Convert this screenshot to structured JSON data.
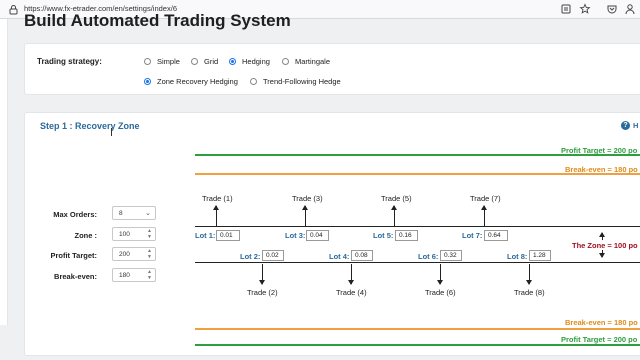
{
  "browser": {
    "url": "https://www.fx-etrader.com/en/settings/index/6"
  },
  "page": {
    "title": "Build Automated Trading System"
  },
  "strategy": {
    "label": "Trading strategy:",
    "options": [
      {
        "label": "Simple",
        "selected": false
      },
      {
        "label": "Grid",
        "selected": false
      },
      {
        "label": "Hedging",
        "selected": true
      },
      {
        "label": "Martingale",
        "selected": false
      }
    ],
    "hedging_options": [
      {
        "label": "Zone Recovery Hedging",
        "selected": true
      },
      {
        "label": "Trend-Following Hedge",
        "selected": false
      }
    ]
  },
  "step": {
    "title": "Step 1 : Recovery Zone",
    "help_label": "H"
  },
  "form": {
    "max_orders": {
      "label": "Max Orders:",
      "value": "8"
    },
    "zone": {
      "label": "Zone :",
      "value": "100"
    },
    "profit_target": {
      "label": "Profit Target:",
      "value": "200"
    },
    "break_even": {
      "label": "Break-even:",
      "value": "180"
    }
  },
  "diagram": {
    "profit_target_label": "Profit Target = 200 po",
    "break_even_label": "Break-even = 180 po",
    "zone_label": "The Zone = 100 po",
    "top_trades": [
      "Trade (1)",
      "Trade (3)",
      "Trade (5)",
      "Trade (7)"
    ],
    "bottom_trades": [
      "Trade (2)",
      "Trade (4)",
      "Trade (6)",
      "Trade (8)"
    ],
    "top_lots": [
      {
        "label": "Lot 1:",
        "value": "0.01"
      },
      {
        "label": "Lot 3:",
        "value": "0.04"
      },
      {
        "label": "Lot 5:",
        "value": "0.16"
      },
      {
        "label": "Lot 7:",
        "value": "0.64"
      }
    ],
    "bottom_lots": [
      {
        "label": "Lot 2:",
        "value": "0.02"
      },
      {
        "label": "Lot 4:",
        "value": "0.08"
      },
      {
        "label": "Lot 6:",
        "value": "0.32"
      },
      {
        "label": "Lot 8:",
        "value": "1.28"
      }
    ]
  }
}
